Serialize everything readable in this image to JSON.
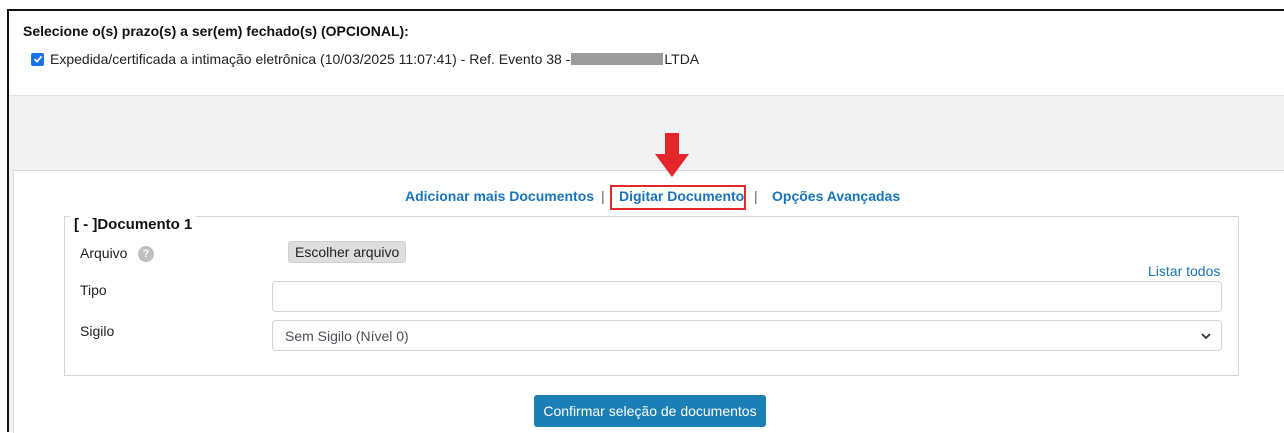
{
  "prazos": {
    "heading": "Selecione o(s) prazo(s) a ser(em) fechado(s) (OPCIONAL):",
    "item_text": "Expedida/certificada a intimação eletrônica (10/03/2025 11:07:41) - Ref. Evento 38 -",
    "item_suffix": "LTDA",
    "checked": true
  },
  "nav": {
    "add_docs": "Adicionar mais Documentos",
    "sep1": "|",
    "digitar": "Digitar Documento",
    "sep2": "|",
    "opcoes": "Opções Avançadas"
  },
  "annotation": {
    "color": "#e5262a"
  },
  "documento": {
    "legend": "[ - ]Documento 1",
    "arquivo_label": "Arquivo",
    "help_icon": "?",
    "choose_file": "Escolher arquivo",
    "listar_todos": "Listar todos",
    "tipo_label": "Tipo",
    "tipo_value": "",
    "sigilo_label": "Sigilo",
    "sigilo_value": "Sem Sigilo (Nível 0)"
  },
  "confirm_label": "Confirmar seleção de documentos",
  "colors": {
    "link": "#1a74b8",
    "primary_button": "#1a7fb4",
    "checkbox": "#1a73e8"
  }
}
